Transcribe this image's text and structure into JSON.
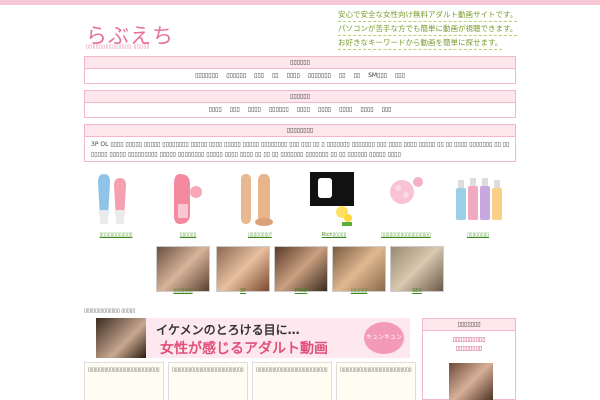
{
  "header": {
    "logo": "らぶえち",
    "subtitle": "▯▯▯▯▯▯▯▯▯▯▯▯▯▯ ▯▯▯▯▯",
    "taglines": [
      "安心で安全な女性向け無料アダルト動画サイトです。",
      "パソコンが苦手な方でも簡単に動画が視聴できます。",
      "お好きなキーワードから動画を簡単に探せます。"
    ]
  },
  "category_box_1": {
    "title": "▯▯▯▯▯▯",
    "items": [
      "▯▯▯▯▯▯▯",
      "▯▯▯▯▯▯",
      "▯▯▯",
      "▯▯",
      "▯▯▯▯",
      "▯▯▯▯▯▯▯",
      "▯▯",
      "▯▯",
      "SM▯▯▯",
      "▯▯▯"
    ]
  },
  "category_box_2": {
    "title": "▯▯▯▯▯▯",
    "items": [
      "▯▯▯▯",
      "▯▯▯",
      "▯▯▯▯",
      "▯▯▯▯▯▯",
      "▯▯▯▯",
      "▯▯▯▯",
      "▯▯▯▯",
      "▯▯▯▯",
      "▯▯▯"
    ]
  },
  "tag_box": {
    "title": "▯▯▯▯▯▯▯▯",
    "lines": [
      "3P OL ▯▯▯▯ ▯▯▯▯▯ ▯▯▯▯▯ ▯▯▯▯▯▯▯▯ ▯▯▯▯▯ ▯▯▯▯ ▯▯▯▯▯ ▯▯▯▯▯ ▯▯▯▯▯▯▯▯ ▯▯▯ ▯▯▯ ▯▯ ▯ ▯▯▯▯▯▯▯ ▯▯▯▯▯▯▯ ▯▯▯ ▯▯▯▯ ▯▯▯▯ ▯▯▯▯▯ ▯▯ ▯▯ ▯▯▯▯ ▯▯▯▯▯▯▯ ▯▯ ▯▯▯▯▯",
      "▯▯▯▯▯ ▯▯▯▯▯ ▯▯▯▯▯▯▯▯▯ ▯▯▯▯▯ ▯▯▯▯▯▯▯▯ ▯▯▯▯▯ ▯▯▯▯ ▯▯▯▯ ▯▯ ▯▯ ▯▯ ▯▯▯▯▯▯▯ ▯▯▯▯▯▯▯ ▯▯ ▯▯ ▯▯▯▯▯▯ ▯▯▯▯▯ ▯▯▯▯"
    ]
  },
  "products": [
    {
      "caption": "▯▯▯▯▯▯▯▯▯▯▯▯",
      "icon": "vibrator-icon"
    },
    {
      "caption": "▯▯▯▯▯▯",
      "icon": "vibrator-pink-icon"
    },
    {
      "caption": "▯▯▯▯▯▯▯▯!",
      "icon": "dildo-icon"
    },
    {
      "caption": "Rich▯▯▯▯▯",
      "icon": "rotor-icon"
    },
    {
      "caption": "▯▯▯▯▯▯▯▯▯▯▯▯▯▯▯▯▯▯",
      "icon": "sponge-icon"
    },
    {
      "caption": "▯▯▯▯▯▯▯▯",
      "icon": "lotion-icon"
    }
  ],
  "videos": [
    {
      "caption": "▯▯▯▯▯▯▯"
    },
    {
      "caption": "3P"
    },
    {
      "caption": "FACE"
    },
    {
      "caption": "▯▯▯▯▯▯"
    },
    {
      "caption": "SEX"
    }
  ],
  "footer_label": "▯▯▯▯▯▯▯▯▯▯▯▯▯ ▯▯▯▯▯",
  "banner": {
    "line1": "イケメンのとろける目に…",
    "line2": "女性が感じるアダルト動画",
    "badge": "キュンキュン"
  },
  "grid_cells": [
    "▯▯▯▯▯▯▯▯▯▯▯▯▯▯▯▯▯▯▯▯▯▯▯▯▯▯",
    "▯▯▯▯▯▯▯▯▯▯▯▯▯▯▯▯▯▯▯▯▯▯▯▯▯▯",
    "▯▯▯▯▯▯▯▯▯▯▯▯▯▯▯▯▯▯▯▯▯▯▯▯▯▯",
    "▯▯▯▯▯▯▯▯▯▯▯▯▯▯▯▯▯▯▯▯▯▯▯▯▯▯"
  ],
  "sidebar": {
    "title": "▯▯▯▯▯▯▯",
    "link1": "▯▯▯▯▯▯▯▯▯▯",
    "link2": "▯▯▯▯▯▯▯▯"
  },
  "colors": {
    "accent": "#e8709a",
    "header_bg": "#fde6ec",
    "border": "#f0b8c8",
    "link": "#3a8a1a",
    "tagline": "#7a9c2e"
  }
}
